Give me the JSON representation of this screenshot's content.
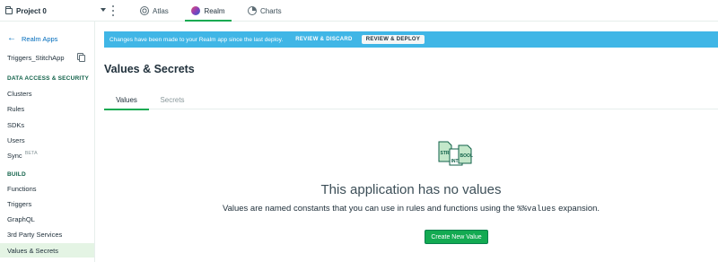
{
  "topbar": {
    "project_name": "Project 0",
    "tabs": [
      {
        "label": "Atlas"
      },
      {
        "label": "Realm"
      },
      {
        "label": "Charts"
      }
    ]
  },
  "sidebar": {
    "back_label": "Realm Apps",
    "app_name": "Triggers_StitchApp",
    "section_data": "DATA ACCESS & SECURITY",
    "section_build": "BUILD",
    "items": [
      {
        "label": "Clusters"
      },
      {
        "label": "Rules"
      },
      {
        "label": "SDKs"
      },
      {
        "label": "Users"
      },
      {
        "label": "Sync",
        "badge": "BETA"
      },
      {
        "label": "Functions"
      },
      {
        "label": "Triggers"
      },
      {
        "label": "GraphQL"
      },
      {
        "label": "3rd Party Services"
      },
      {
        "label": "Values & Secrets",
        "active": true
      }
    ]
  },
  "banner": {
    "message": "Changes have been made to your Realm app since the last deploy.",
    "discard_label": "REVIEW & DISCARD",
    "deploy_label": "REVIEW & DEPLOY"
  },
  "main": {
    "title": "Values & Secrets",
    "tabs": [
      {
        "label": "Values",
        "active": true
      },
      {
        "label": "Secrets",
        "active": false
      }
    ],
    "empty": {
      "icon_labels": [
        "STR",
        "INT",
        "BOOL"
      ],
      "title": "This application has no values",
      "desc_before": "Values are named constants that you can use in rules and functions using the ",
      "desc_code": "%%values",
      "desc_after": " expansion.",
      "button_label": "Create New Value"
    }
  },
  "colors": {
    "accent_green": "#13aa52",
    "banner_blue": "#40b6e6",
    "link_blue": "#006cbc",
    "section_green": "#116149",
    "active_item_bg": "#e4f4e4"
  }
}
